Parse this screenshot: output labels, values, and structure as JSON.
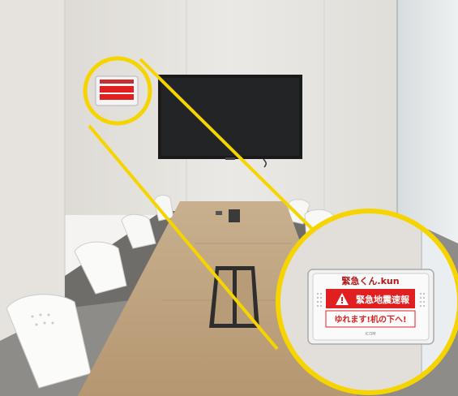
{
  "device": {
    "header": "緊急くん.kun",
    "alert_title": "緊急地震速報",
    "alert_message": "ゆれます!机の下へ!",
    "footer_mark": "ICOM",
    "alert_color": "#e02020",
    "highlight_color": "#f6d400"
  },
  "icons": [
    "warning-triangle-icon"
  ]
}
